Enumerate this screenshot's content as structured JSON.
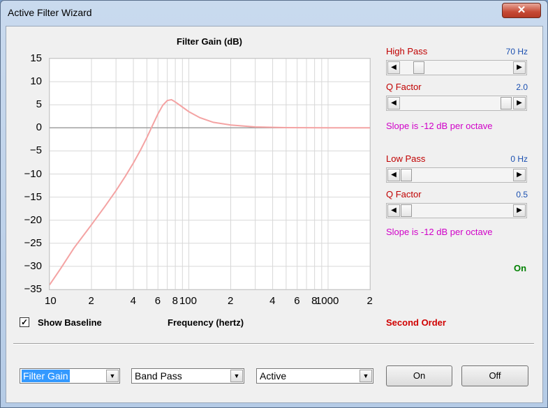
{
  "window": {
    "title": "Active Filter Wizard",
    "close_glyph": "✕"
  },
  "chart_data": {
    "type": "line",
    "title": "Filter Gain (dB)",
    "xlabel": "Frequency (hertz)",
    "ylabel": "",
    "x_scale": "log",
    "xlim": [
      10,
      2000
    ],
    "ylim": [
      -35,
      15
    ],
    "y_ticks": [
      "15",
      "10",
      "5",
      "0",
      "−5",
      "−10",
      "−15",
      "−20",
      "−25",
      "−30",
      "−35"
    ],
    "x_ticks": [
      "10",
      "2",
      "4",
      "6",
      "8",
      "100",
      "2",
      "4",
      "6",
      "8",
      "1000",
      "2"
    ],
    "grid": true,
    "baseline_color": "#a0a0a0",
    "series": [
      {
        "color": "#f4a3a3",
        "x": [
          10,
          12,
          15,
          20,
          25,
          30,
          35,
          40,
          45,
          50,
          55,
          60,
          65,
          70,
          75,
          80,
          90,
          100,
          120,
          150,
          200,
          300,
          500,
          1000,
          2000
        ],
        "y": [
          -34,
          -30.5,
          -26,
          -21,
          -17,
          -13.6,
          -10.5,
          -7.6,
          -4.8,
          -2.1,
          0.6,
          3.0,
          4.9,
          5.9,
          6.1,
          5.6,
          4.5,
          3.5,
          2.2,
          1.2,
          0.6,
          0.2,
          0.05,
          0,
          0
        ]
      }
    ]
  },
  "show_baseline": {
    "label": "Show Baseline",
    "checked": true,
    "check_glyph": "✓"
  },
  "highpass": {
    "label": "High Pass",
    "value": "70 Hz",
    "level": 0.12
  },
  "hp_q": {
    "label": "Q Factor",
    "value": "2.0",
    "level": 0.98
  },
  "hp_slope": "Slope is -12 dB per octave",
  "lowpass": {
    "label": "Low Pass",
    "value": "0 Hz",
    "level": 0.0
  },
  "lp_q": {
    "label": "Q Factor",
    "value": "0.5",
    "level": 0.0
  },
  "lp_slope": "Slope is -12 dB per octave",
  "status": {
    "text": "On",
    "color": "#008000"
  },
  "order": {
    "text": "Second Order",
    "color": "#d00000"
  },
  "combos": {
    "display": "Filter Gain",
    "type": "Band Pass",
    "mode": "Active",
    "arrow_glyph": "▼"
  },
  "buttons": {
    "on": "On",
    "off": "Off"
  },
  "scroll_glyphs": {
    "left": "◀",
    "right": "▶"
  }
}
